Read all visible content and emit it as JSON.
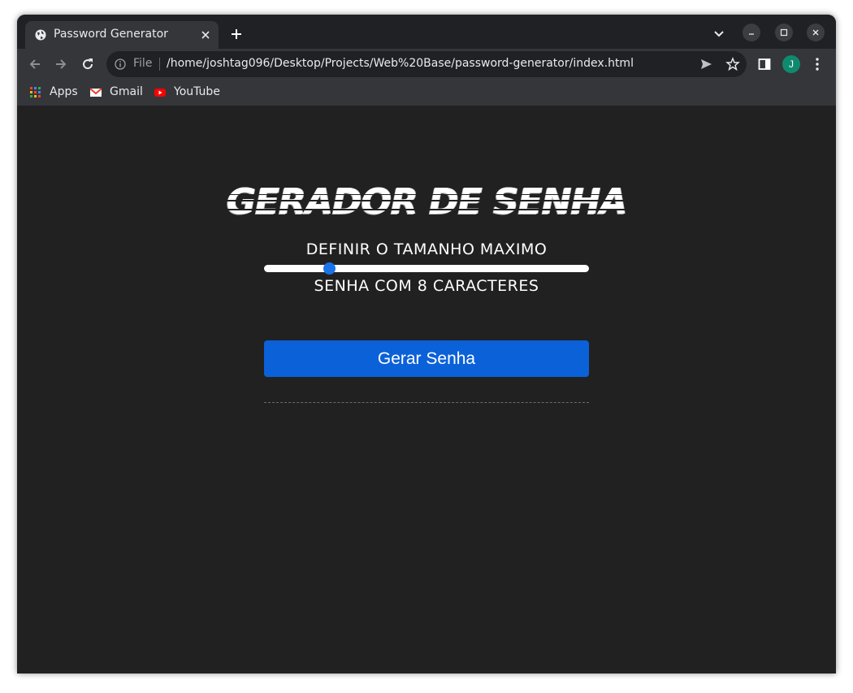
{
  "browser": {
    "tab": {
      "title": "Password Generator"
    },
    "address": {
      "scheme_label": "File",
      "url": "/home/joshtag096/Desktop/Projects/Web%20Base/password-generator/index.html"
    },
    "profile_initial": "J",
    "bookmarks": [
      {
        "label": "Apps",
        "icon": "apps-grid-icon"
      },
      {
        "label": "Gmail",
        "icon": "gmail-icon"
      },
      {
        "label": "YouTube",
        "icon": "youtube-icon"
      }
    ]
  },
  "page": {
    "heading": "GERADOR DE SENHA",
    "max_length_label": "DEFINIR O TAMANHO MAXIMO",
    "length_text": "SENHA COM 8 CARACTERES",
    "slider": {
      "value_fraction": 0.2
    },
    "generate_button": "Gerar Senha",
    "result": ""
  },
  "colors": {
    "page_bg": "#212121",
    "accent": "#0b61d8",
    "slider_thumb": "#1a73e8"
  }
}
